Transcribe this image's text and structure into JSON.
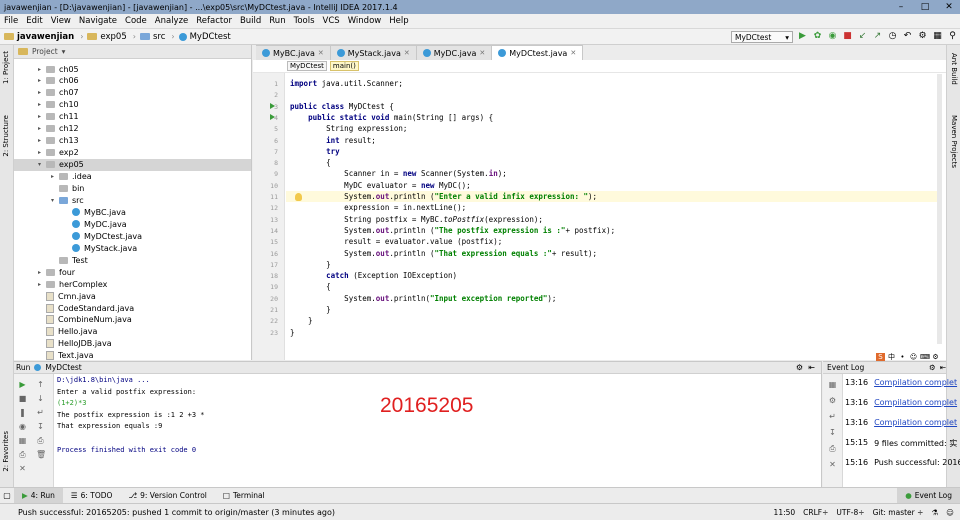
{
  "window": {
    "title": "javawenjian - [D:\\javawenjian] - [javawenjian] - ...\\exp05\\src\\MyDCtest.java - IntelliJ IDEA 2017.1.4"
  },
  "menu": [
    "File",
    "Edit",
    "View",
    "Navigate",
    "Code",
    "Analyze",
    "Refactor",
    "Build",
    "Run",
    "Tools",
    "VCS",
    "Window",
    "Help"
  ],
  "nav": {
    "crumbs": [
      "javawenjian",
      "exp05",
      "src",
      "MyDCtest"
    ],
    "run_config": "MyDCtest"
  },
  "left_strip": [
    "1: Project",
    "2: Structure",
    "2: Favorites"
  ],
  "right_strip": [
    "Ant Build",
    "Maven Projects"
  ],
  "project": {
    "header": "Project",
    "tree": [
      {
        "label": "ch05",
        "level": 1,
        "kind": "folder",
        "arrow": "▸"
      },
      {
        "label": "ch06",
        "level": 1,
        "kind": "folder",
        "arrow": "▸"
      },
      {
        "label": "ch07",
        "level": 1,
        "kind": "folder",
        "arrow": "▸"
      },
      {
        "label": "ch10",
        "level": 1,
        "kind": "folder",
        "arrow": "▸"
      },
      {
        "label": "ch11",
        "level": 1,
        "kind": "folder",
        "arrow": "▸"
      },
      {
        "label": "ch12",
        "level": 1,
        "kind": "folder",
        "arrow": "▸"
      },
      {
        "label": "ch13",
        "level": 1,
        "kind": "folder",
        "arrow": "▸"
      },
      {
        "label": "exp2",
        "level": 1,
        "kind": "folder",
        "arrow": "▸"
      },
      {
        "label": "exp05",
        "level": 1,
        "kind": "folder",
        "arrow": "▾",
        "selected": true
      },
      {
        "label": ".idea",
        "level": 2,
        "kind": "folder",
        "arrow": "▸"
      },
      {
        "label": "bin",
        "level": 2,
        "kind": "folder",
        "arrow": ""
      },
      {
        "label": "src",
        "level": 2,
        "kind": "src",
        "arrow": "▾"
      },
      {
        "label": "MyBC.java",
        "level": 3,
        "kind": "java",
        "arrow": ""
      },
      {
        "label": "MyDC.java",
        "level": 3,
        "kind": "java",
        "arrow": ""
      },
      {
        "label": "MyDCtest.java",
        "level": 3,
        "kind": "java",
        "arrow": ""
      },
      {
        "label": "MyStack.java",
        "level": 3,
        "kind": "java",
        "arrow": ""
      },
      {
        "label": "Test",
        "level": 2,
        "kind": "folder",
        "arrow": ""
      },
      {
        "label": "four",
        "level": 1,
        "kind": "folder",
        "arrow": "▸"
      },
      {
        "label": "herComplex",
        "level": 1,
        "kind": "folder",
        "arrow": "▸"
      },
      {
        "label": "Cmn.java",
        "level": 1,
        "kind": "file",
        "arrow": ""
      },
      {
        "label": "CodeStandard.java",
        "level": 1,
        "kind": "file",
        "arrow": ""
      },
      {
        "label": "CombineNum.java",
        "level": 1,
        "kind": "file",
        "arrow": ""
      },
      {
        "label": "Hello.java",
        "level": 1,
        "kind": "file",
        "arrow": ""
      },
      {
        "label": "HelloJDB.java",
        "level": 1,
        "kind": "file",
        "arrow": ""
      },
      {
        "label": "Text.java",
        "level": 1,
        "kind": "file",
        "arrow": ""
      }
    ]
  },
  "editor": {
    "tabs": [
      {
        "label": "MyBC.java",
        "active": false
      },
      {
        "label": "MyStack.java",
        "active": false
      },
      {
        "label": "MyDC.java",
        "active": false
      },
      {
        "label": "MyDCtest.java",
        "active": true
      }
    ],
    "breadcrumb": [
      "MyDCtest",
      "main()"
    ],
    "lines": [
      [
        [
          "kw",
          "import "
        ],
        [
          "",
          "java.util.Scanner;"
        ]
      ],
      [],
      [
        [
          "kw",
          "public class "
        ],
        [
          "",
          "MyDCtest {"
        ]
      ],
      [
        [
          "",
          "    "
        ],
        [
          "kw",
          "public static void "
        ],
        [
          "",
          "main(String [] args) {"
        ]
      ],
      [
        [
          "",
          "        String expression;"
        ]
      ],
      [
        [
          "",
          "        "
        ],
        [
          "kw",
          "int "
        ],
        [
          "",
          "result;"
        ]
      ],
      [
        [
          "",
          "        "
        ],
        [
          "kw",
          "try"
        ]
      ],
      [
        [
          "",
          "        {"
        ]
      ],
      [
        [
          "",
          "            Scanner in = "
        ],
        [
          "kw",
          "new "
        ],
        [
          "",
          "Scanner(System."
        ],
        [
          "fld",
          "in"
        ],
        [
          "",
          "); "
        ]
      ],
      [
        [
          "",
          "            MyDC evaluator = "
        ],
        [
          "kw",
          "new "
        ],
        [
          "",
          "MyDC();"
        ]
      ],
      [
        [
          "",
          "            System."
        ],
        [
          "fld",
          "out"
        ],
        [
          "",
          ".println ("
        ],
        [
          "str",
          "\"Enter a valid infix expression: \""
        ],
        [
          "",
          ");"
        ]
      ],
      [
        [
          "",
          "            expression = in.nextLine();"
        ]
      ],
      [
        [
          "",
          "            String postfix = MyBC."
        ],
        [
          "it",
          "toPostfix"
        ],
        [
          "",
          "(expression);"
        ]
      ],
      [
        [
          "",
          "            System."
        ],
        [
          "fld",
          "out"
        ],
        [
          "",
          ".println ("
        ],
        [
          "str",
          "\"The postfix expression is :\""
        ],
        [
          "",
          ""
        ],
        [
          "",
          "+ postfix);"
        ]
      ],
      [
        [
          "",
          "            result = evaluator.value (postfix);"
        ]
      ],
      [
        [
          "",
          "            System."
        ],
        [
          "fld",
          "out"
        ],
        [
          "",
          ".println ("
        ],
        [
          "str",
          "\"That expression equals :\""
        ],
        [
          "",
          ""
        ],
        [
          "",
          "+ result);"
        ]
      ],
      [
        [
          "",
          "        }"
        ]
      ],
      [
        [
          "",
          "        "
        ],
        [
          "kw",
          "catch "
        ],
        [
          "",
          "(Exception IOException)"
        ]
      ],
      [
        [
          "",
          "        {"
        ]
      ],
      [
        [
          "",
          "            System."
        ],
        [
          "fld",
          "out"
        ],
        [
          "",
          ".println("
        ],
        [
          "str",
          "\"Input exception reported\""
        ],
        [
          "",
          ");"
        ]
      ],
      [
        [
          "",
          "        }"
        ]
      ],
      [
        [
          "",
          "    }"
        ]
      ],
      [
        [
          "",
          "}"
        ]
      ]
    ]
  },
  "run": {
    "header_label": "Run",
    "config": "MyDCtest",
    "console": [
      {
        "text": "D:\\jdk1.8\\bin\\java ...",
        "color": "#000080"
      },
      {
        "text": "Enter a valid postfix expression:",
        "color": "#000000"
      },
      {
        "text": "(1+2)*3",
        "color": "#2a9d2a"
      },
      {
        "text": "The postfix expression is :1 2 +3 *",
        "color": "#000000"
      },
      {
        "text": "That expression equals :9",
        "color": "#000000"
      },
      {
        "text": "",
        "color": "#000000"
      },
      {
        "text": "Process finished with exit code 0",
        "color": "#000080"
      }
    ],
    "stamp": "20165205"
  },
  "event_log": {
    "title": "Event Log",
    "entries": [
      {
        "time": "13:16",
        "msg": "Compilation complet",
        "link": true
      },
      {
        "time": "13:16",
        "msg": "Compilation complet",
        "link": true
      },
      {
        "time": "13:16",
        "msg": "Compilation complet",
        "link": true
      },
      {
        "time": "15:15",
        "msg": "9 files committed: 实",
        "link": false
      },
      {
        "time": "15:16",
        "msg": "Push successful: 2016",
        "link": false
      }
    ]
  },
  "bottom_tabs": [
    {
      "label": "4: Run",
      "active": true
    },
    {
      "label": "6: TODO",
      "active": false
    },
    {
      "label": "9: Version Control",
      "active": false
    },
    {
      "label": "Terminal",
      "active": false
    }
  ],
  "event_log_tab": "Event Log",
  "status": {
    "message": "Push successful: 20165205: pushed 1 commit to origin/master (3 minutes ago)",
    "position": "11:50",
    "line_sep": "CRLF÷",
    "encoding": "UTF-8÷",
    "git": "Git: master ÷"
  },
  "ime": [
    "中",
    "•",
    "☺",
    "⌨",
    "⚙"
  ],
  "colors": {
    "accent_run": "#3a9b3a",
    "stamp": "#e02020",
    "link": "#2047c2"
  }
}
